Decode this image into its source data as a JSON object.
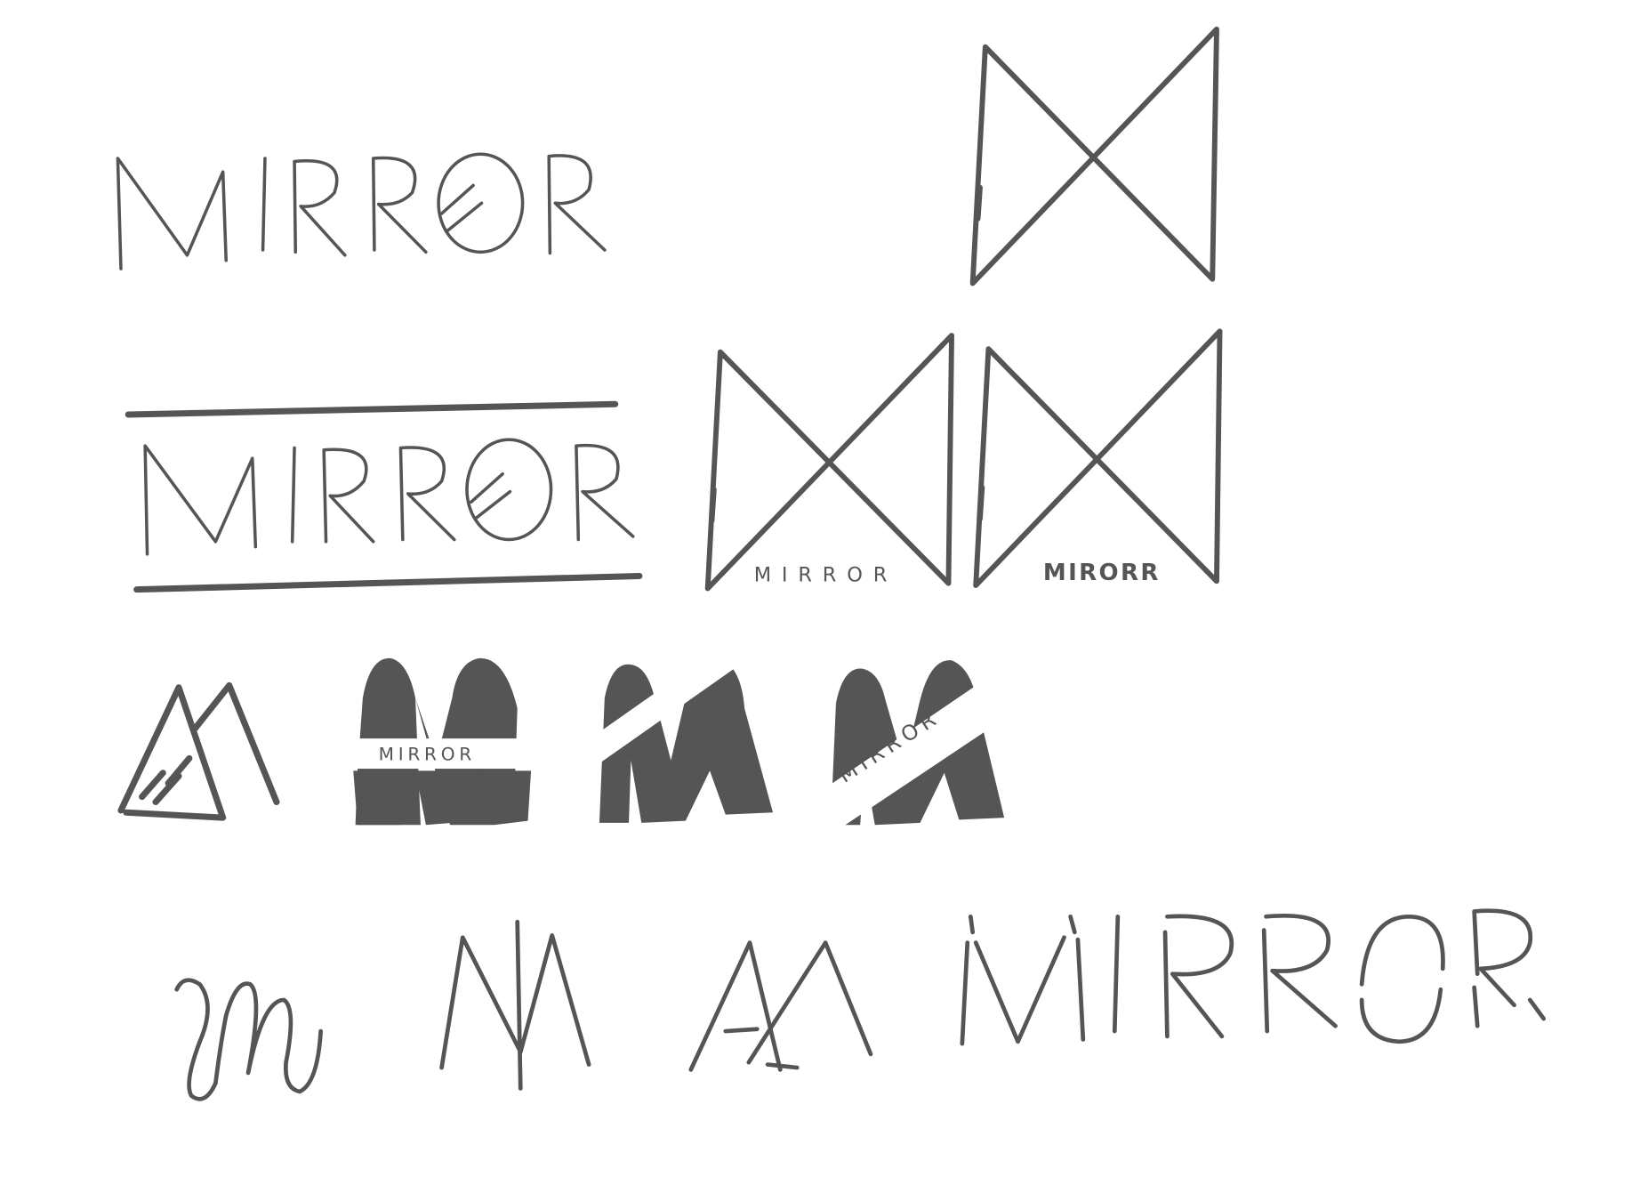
{
  "sketches": {
    "wordmark_plain": "MIRROR",
    "wordmark_underlined": "MIRROR",
    "bowtie_label_1": "MIRROR",
    "bowtie_label_2": "MIRORR",
    "solid_m_band_label_1": "MIRROR",
    "solid_m_band_label_3": "MIRROR",
    "broken_wordmark": "MIRROR"
  },
  "colors": {
    "ink": "#555555",
    "background": "#ffffff"
  }
}
